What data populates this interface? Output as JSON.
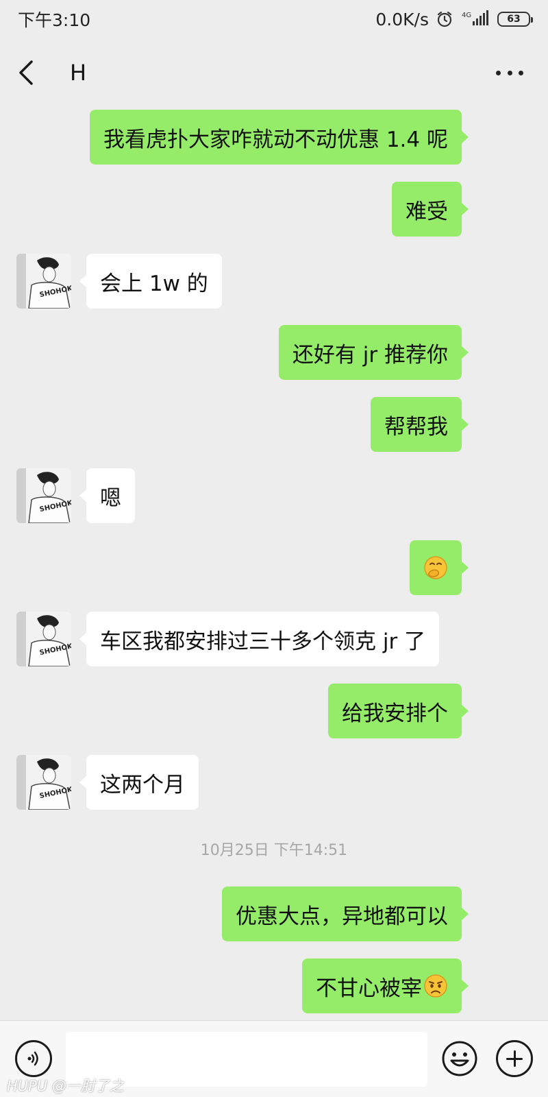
{
  "status_bar": {
    "time": "下午3:10",
    "network_speed": "0.0K/s",
    "signal_label": "4G",
    "battery": "63",
    "icons": [
      "alarm-clock-icon",
      "signal-icon",
      "battery-icon"
    ]
  },
  "header": {
    "title": "H",
    "back_icon": "chevron-left-icon",
    "more_icon": "more-dots-icon"
  },
  "messages": [
    {
      "side": "out",
      "text": "我看虎扑大家咋就动不动优惠 1.4 呢"
    },
    {
      "side": "out",
      "text": "难受"
    },
    {
      "side": "in",
      "text": "会上 1w 的"
    },
    {
      "side": "out",
      "text": "还好有 jr 推荐你"
    },
    {
      "side": "out",
      "text": "帮帮我"
    },
    {
      "side": "in",
      "text": "嗯"
    },
    {
      "side": "out",
      "emoji": "covering-mouth-emoji"
    },
    {
      "side": "in",
      "text": "车区我都安排过三十多个领克 jr 了"
    },
    {
      "side": "out",
      "text": "给我安排个"
    },
    {
      "side": "in",
      "text": "这两个月"
    },
    {
      "side": "out",
      "text": "优惠大点，异地都可以"
    },
    {
      "side": "out",
      "text": "不甘心被宰",
      "emoji": "frowning-face-emoji"
    }
  ],
  "timestamp": "10月25日 下午14:51",
  "input_bar": {
    "voice_icon": "voice-icon",
    "input_value": "",
    "emoji_icon": "smiley-icon",
    "plus_icon": "plus-icon"
  },
  "watermark": "HUPU @一肘了之",
  "colors": {
    "background": "#ededed",
    "outgoing_bubble": "#95ec69",
    "incoming_bubble": "#ffffff",
    "timestamp_text": "#a6a6a6"
  }
}
